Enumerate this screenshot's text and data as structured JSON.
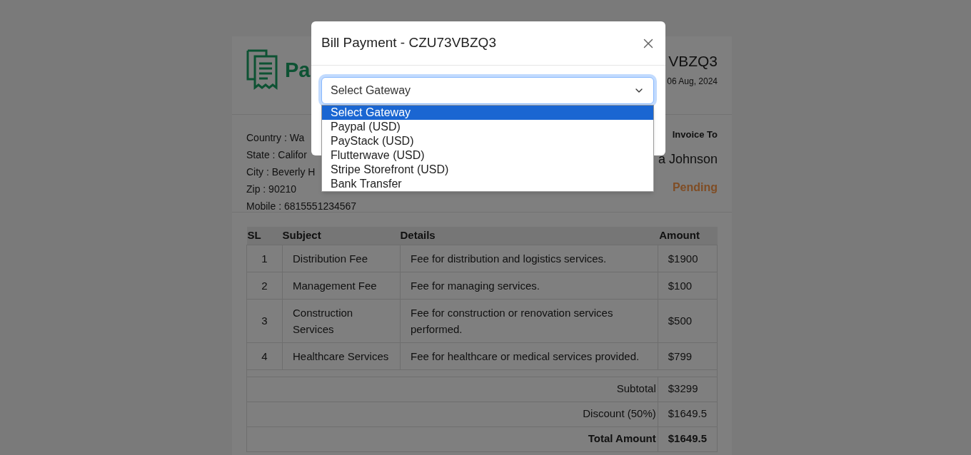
{
  "invoice": {
    "logo_text": "Pa",
    "number": "VBZQ3",
    "date": "06 Aug, 2024",
    "address": [
      "Country : Wa",
      "State : Califor",
      "City : Beverly H",
      "Zip : 90210",
      "Mobile : 6815551234567"
    ],
    "invoice_to_label": "Invoice To",
    "customer": "a Johnson",
    "status": "Pending"
  },
  "table": {
    "columns": [
      "SL",
      "Subject",
      "Details",
      "Amount"
    ],
    "rows": [
      [
        "1",
        "Distribution Fee",
        "Fee for distribution and logistics services.",
        "$1900"
      ],
      [
        "2",
        "Management Fee",
        "Fee for managing services.",
        "$100"
      ],
      [
        "3",
        "Construction Services",
        "Fee for construction or renovation services performed.",
        "$500"
      ],
      [
        "4",
        "Healthcare Services",
        "Fee for healthcare or medical services provided.",
        "$799"
      ]
    ],
    "totals": [
      {
        "kind": "line",
        "label": "Subtotal",
        "value": "$3299"
      },
      {
        "kind": "line",
        "label": "Discount (50%)",
        "value": "$1649.5"
      },
      {
        "kind": "total",
        "label": "Total Amount",
        "value": "$1649.5"
      }
    ]
  },
  "modal": {
    "title": "Bill Payment - CZU73VBZQ3",
    "select": {
      "value": "Select Gateway",
      "expanded": true
    },
    "options": [
      {
        "label": "Select Gateway",
        "selected": true
      },
      {
        "label": "Paypal (USD)",
        "selected": false
      },
      {
        "label": "PayStack (USD)",
        "selected": false
      },
      {
        "label": "Flutterwave (USD)",
        "selected": false
      },
      {
        "label": "Stripe Storefront (USD)",
        "selected": false
      },
      {
        "label": "Bank Transfer",
        "selected": false
      }
    ]
  }
}
